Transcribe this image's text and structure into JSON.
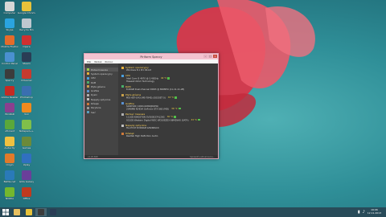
{
  "desktop": {
    "icons": [
      {
        "label": "Computer",
        "color": "#d6d6d6"
      },
      {
        "label": "Google Chrome",
        "color": "#e7c23a"
      },
      {
        "label": "Skype",
        "color": "#2aa4e0"
      },
      {
        "label": "Recycle Bin",
        "color": "#bfc7cf"
      },
      {
        "label": "Mozilla Firefox",
        "color": "#e46b2a"
      },
      {
        "label": "Opera",
        "color": "#d03030"
      },
      {
        "label": "Control Panel",
        "color": "#4a90d0"
      },
      {
        "label": "Steam",
        "color": "#2a3d55"
      },
      {
        "label": "Speccy",
        "color": "#3c3c3c"
      },
      {
        "label": "CCleaner",
        "color": "#c63b2f"
      },
      {
        "label": "Adobe Reader",
        "color": "#c42b23"
      },
      {
        "label": "Photoshop",
        "color": "#3a6fb0"
      },
      {
        "label": "WinRAR",
        "color": "#8a3f8f"
      },
      {
        "label": "VLC",
        "color": "#f08a1e"
      },
      {
        "label": "uTorrent",
        "color": "#5aa83a"
      },
      {
        "label": "Notepad++",
        "color": "#7fbf4a"
      },
      {
        "label": "Audacity",
        "color": "#f0c040"
      },
      {
        "label": "Games",
        "color": "#6b8a3a"
      },
      {
        "label": "Origin",
        "color": "#e07a2a"
      },
      {
        "label": "Uplay",
        "color": "#3070c0"
      },
      {
        "label": "Battle.net",
        "color": "#2a7ab8"
      },
      {
        "label": "GOG Galaxy",
        "color": "#6a3f9a"
      },
      {
        "label": "NVIDIA",
        "color": "#74b72e"
      },
      {
        "label": "Office",
        "color": "#c03a1e"
      }
    ]
  },
  "window": {
    "title": "Piriform Speccy",
    "menu": [
      "Plik",
      "Widok",
      "Pomoc"
    ],
    "sidebar": [
      {
        "label": "Podsumowanie",
        "color": "#9bd14a"
      },
      {
        "label": "System operacyjny",
        "color": "#e8b23a"
      },
      {
        "label": "CPU",
        "color": "#4aa0e0"
      },
      {
        "label": "RAM",
        "color": "#4ab06a"
      },
      {
        "label": "Płyta główna",
        "color": "#c8a04a"
      },
      {
        "label": "Grafika",
        "color": "#5a90d0"
      },
      {
        "label": "Dyski",
        "color": "#b0b0b0"
      },
      {
        "label": "Napędy optyczne",
        "color": "#c0c0c0"
      },
      {
        "label": "Dźwięk",
        "color": "#d07a3a"
      },
      {
        "label": "Peryferia",
        "color": "#9a9a9a"
      },
      {
        "label": "Sieć",
        "color": "#5aa0c0"
      }
    ],
    "sections": [
      {
        "heading": "System operacyjny",
        "color": "#e8b23a",
        "lines": [
          {
            "text": "Windows 8.1 Pro 64-bit",
            "temp": ""
          }
        ]
      },
      {
        "heading": "CPU",
        "color": "#4aa0e0",
        "lines": [
          {
            "text": "Intel Core i5 4670 @ 3.40GHz",
            "temp": "40 °C"
          },
          {
            "text": "Haswell 22nm Technology",
            "temp": ""
          }
        ]
      },
      {
        "heading": "RAM",
        "color": "#4ab06a",
        "lines": [
          {
            "text": "8,00GB Dual-Channel DDR3 @ 800MHz (11-11-11-28)",
            "temp": ""
          }
        ]
      },
      {
        "heading": "Płyta główna",
        "color": "#c8a04a",
        "lines": [
          {
            "text": "MSI H87-G43 (MS-7845) (SOCKET 0)",
            "temp": "33 °C"
          }
        ]
      },
      {
        "heading": "Grafika",
        "color": "#5a90d0",
        "lines": [
          {
            "text": "S24D590 (1920x1080@60Hz)",
            "temp": ""
          },
          {
            "text": "2048MB NVIDIA GeForce GTX 660 (MSI)",
            "temp": "36 °C"
          }
        ]
      },
      {
        "heading": "Pamięć masowa",
        "color": "#b0b0b0",
        "lines": [
          {
            "text": "111GB KINGSTON SV300S37A120G",
            "temp": "30 °C"
          },
          {
            "text": "931GB Western Digital WDC WD10EZEX-08M2NA0 (SATA)",
            "temp": "33 °C"
          }
        ]
      },
      {
        "heading": "Napędy optyczne",
        "color": "#c0c0c0",
        "lines": [
          {
            "text": "HL-DT-ST DVDRAM GH24NSC0",
            "temp": ""
          }
        ]
      },
      {
        "heading": "Dźwięk",
        "color": "#d07a3a",
        "lines": [
          {
            "text": "Realtek High Definition Audio",
            "temp": ""
          }
        ]
      }
    ],
    "status_left": "v1.26.698",
    "status_right": "Sprawdź uaktualnienia..."
  },
  "taskbar": {
    "apps": [
      {
        "name": "explorer",
        "color": "#e8c060"
      },
      {
        "name": "chrome",
        "color": "#e7c23a"
      },
      {
        "name": "speccy",
        "color": "#3c3c3c",
        "active": true
      },
      {
        "name": "steam",
        "color": "#2a3d55"
      }
    ],
    "time": "19:06",
    "date": "12.11.2013"
  }
}
